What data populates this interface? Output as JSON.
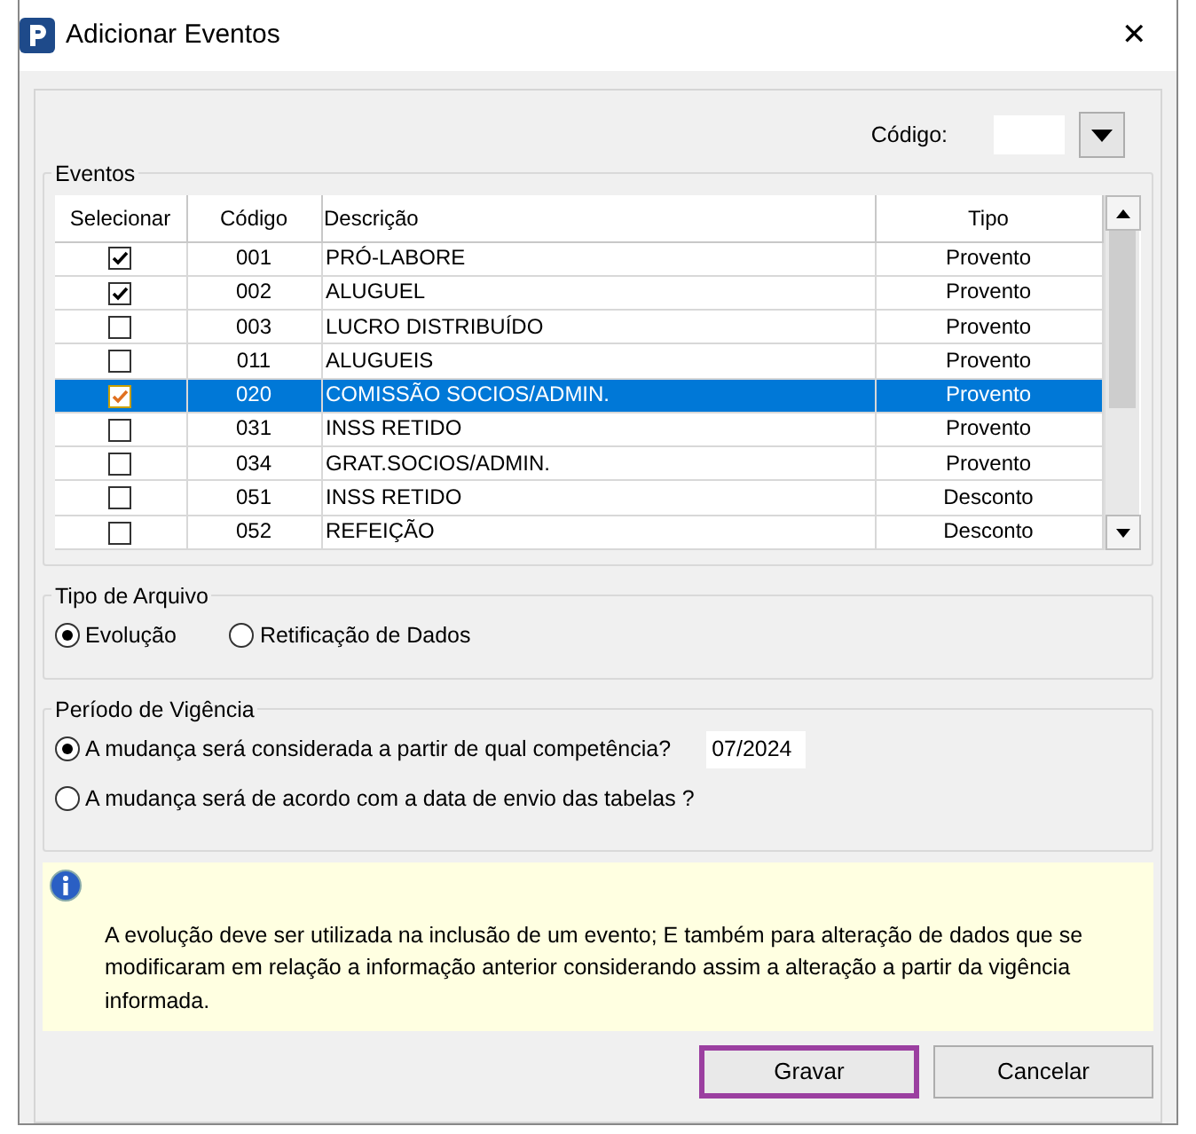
{
  "window": {
    "title": "Adicionar Eventos",
    "close": "✕"
  },
  "codigo": {
    "label": "Código:"
  },
  "eventos": {
    "title": "Eventos",
    "columns": [
      "Selecionar",
      "Código",
      "Descrição",
      "Tipo"
    ],
    "rows": [
      {
        "checked": true,
        "selected": false,
        "code": "001",
        "description": "PRÓ-LABORE",
        "type": "Provento"
      },
      {
        "checked": true,
        "selected": false,
        "code": "002",
        "description": "ALUGUEL",
        "type": "Provento"
      },
      {
        "checked": false,
        "selected": false,
        "code": "003",
        "description": "LUCRO DISTRIBUÍDO",
        "type": "Provento"
      },
      {
        "checked": false,
        "selected": false,
        "code": "011",
        "description": "ALUGUEIS",
        "type": "Provento"
      },
      {
        "checked": true,
        "selected": true,
        "code": "020",
        "description": "COMISSÃO SOCIOS/ADMIN.",
        "type": "Provento"
      },
      {
        "checked": false,
        "selected": false,
        "code": "031",
        "description": "INSS RETIDO",
        "type": "Provento"
      },
      {
        "checked": false,
        "selected": false,
        "code": "034",
        "description": "GRAT.SOCIOS/ADMIN.",
        "type": "Provento"
      },
      {
        "checked": false,
        "selected": false,
        "code": "051",
        "description": "INSS RETIDO",
        "type": "Desconto"
      },
      {
        "checked": false,
        "selected": false,
        "code": "052",
        "description": "REFEIÇÃO",
        "type": "Desconto"
      }
    ]
  },
  "tipo_arquivo": {
    "title": "Tipo de Arquivo",
    "options": [
      {
        "label": "Evolução",
        "selected": true
      },
      {
        "label": "Retificação de Dados",
        "selected": false
      }
    ]
  },
  "periodo": {
    "title": "Período de Vigência",
    "options": [
      {
        "label": "A mudança será considerada a partir de qual competência?",
        "selected": true,
        "value": "07/2024"
      },
      {
        "label": "A mudança será de acordo com a data de envio das tabelas ?",
        "selected": false
      }
    ]
  },
  "info": "A evolução deve ser utilizada na inclusão de um evento; E também para alteração de dados que se modificaram em relação a informação anterior considerando assim a alteração a partir da vigência informada.",
  "buttons": [
    {
      "label": "Gravar",
      "highlighted": true
    },
    {
      "label": "Cancelar",
      "highlighted": false
    }
  ]
}
